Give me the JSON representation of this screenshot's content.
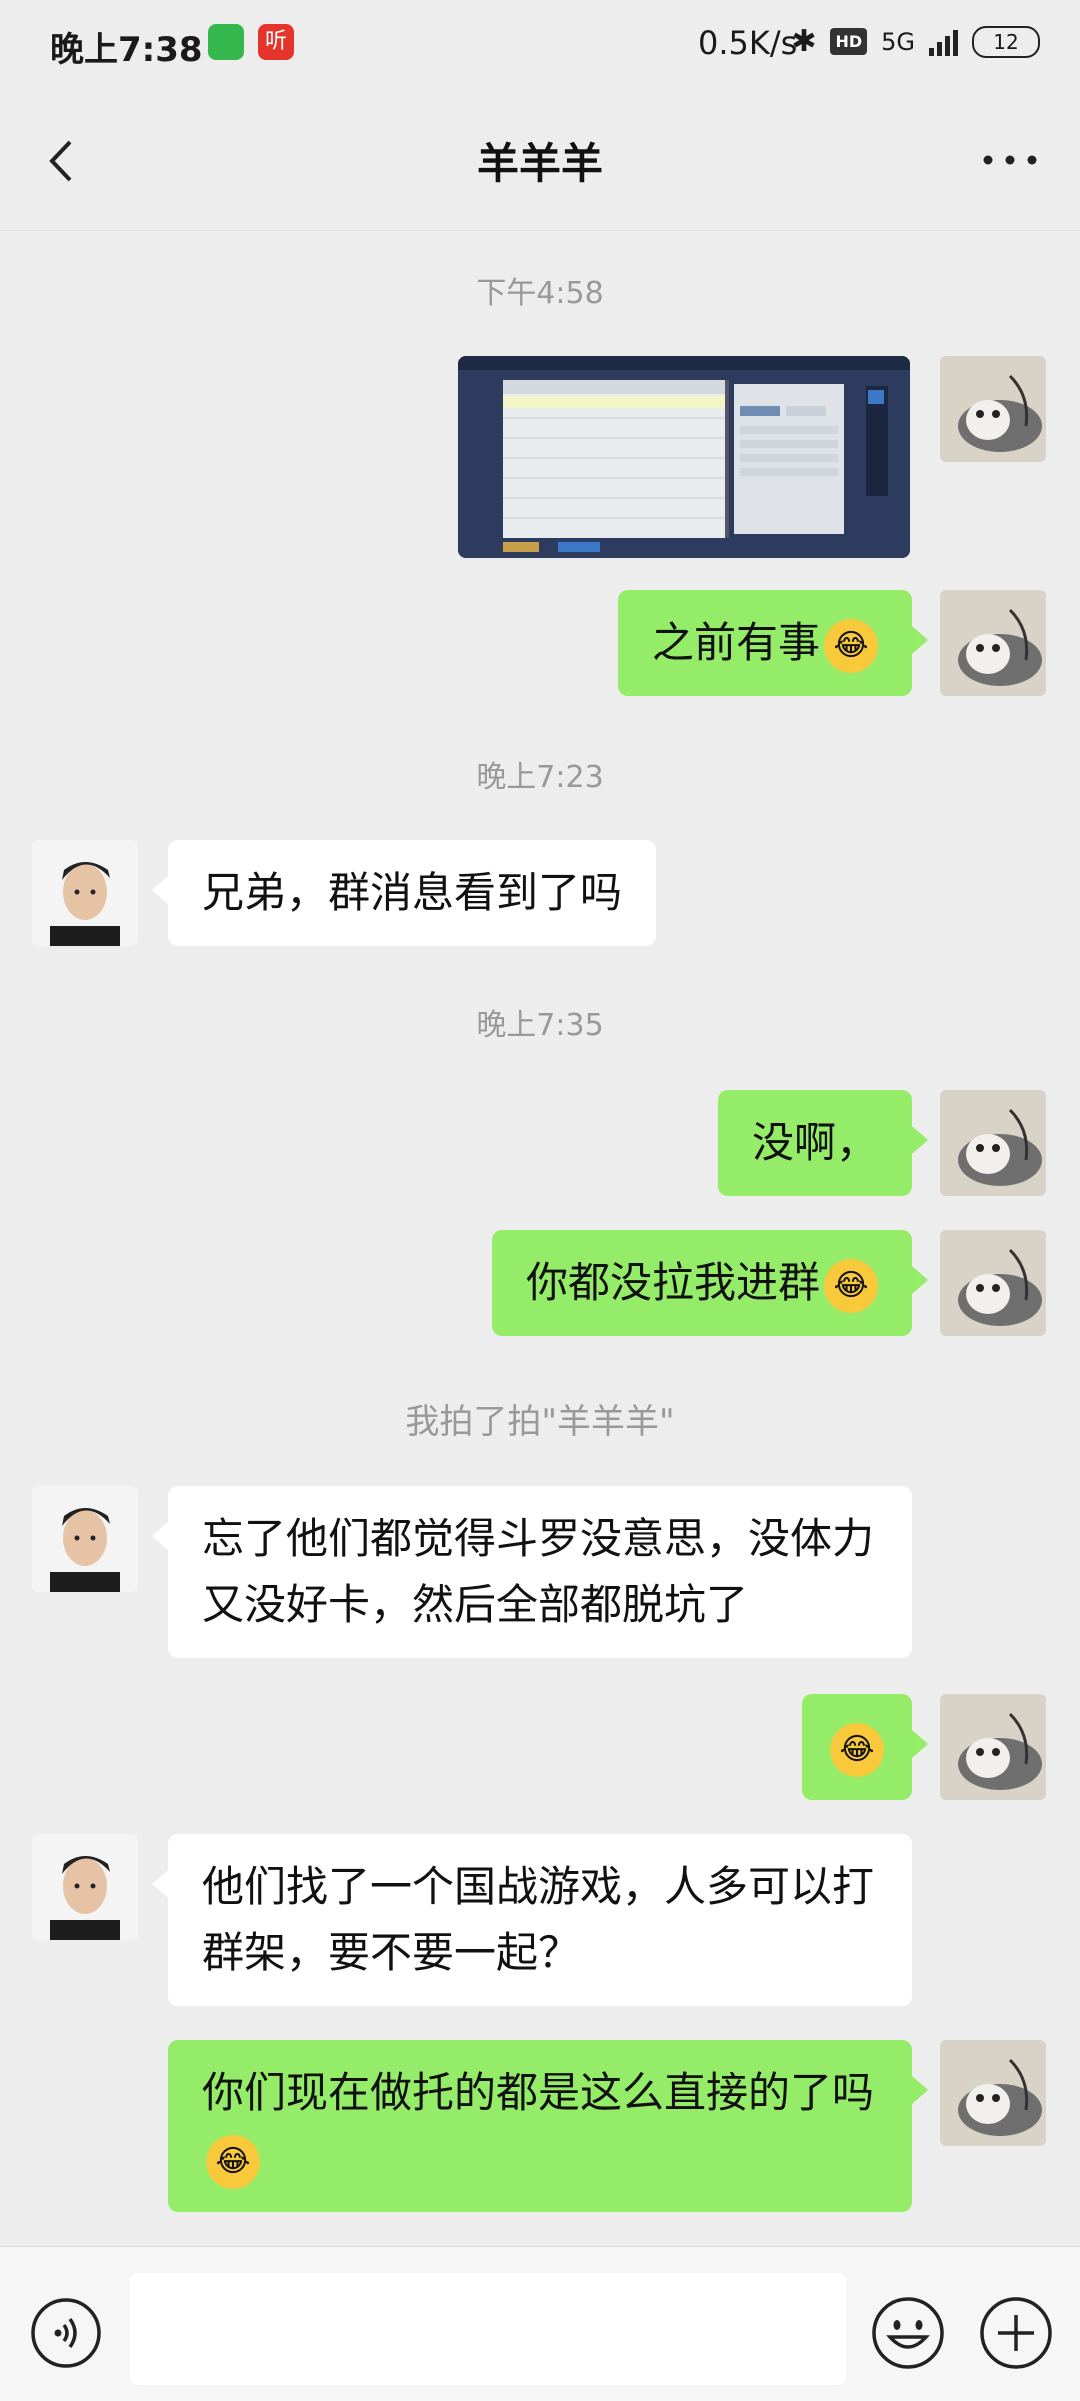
{
  "status_bar": {
    "time": "晚上7:38",
    "ting_app": "听",
    "network_speed": "0.5K/s",
    "hd": "HD",
    "signal": "5G",
    "battery": "12"
  },
  "header": {
    "title": "羊羊羊"
  },
  "messages": {
    "t1": "下午4:58",
    "m2": "之前有事",
    "t2": "晚上7:23",
    "m3": "兄弟，群消息看到了吗",
    "t3": "晚上7:35",
    "m4": "没啊，",
    "m5": "你都没拉我进群",
    "sys": "我拍了拍\"羊羊羊\"",
    "m6": "忘了他们都觉得斗罗没意思，没体力又没好卡，然后全部都脱坑了",
    "m8": "他们找了一个国战游戏，人多可以打群架，要不要一起？",
    "m9": "你们现在做托的都是这么直接的了吗"
  },
  "colors": {
    "my_bubble": "#95ec69",
    "friend_bubble": "#ffffff",
    "background": "#ededed"
  }
}
